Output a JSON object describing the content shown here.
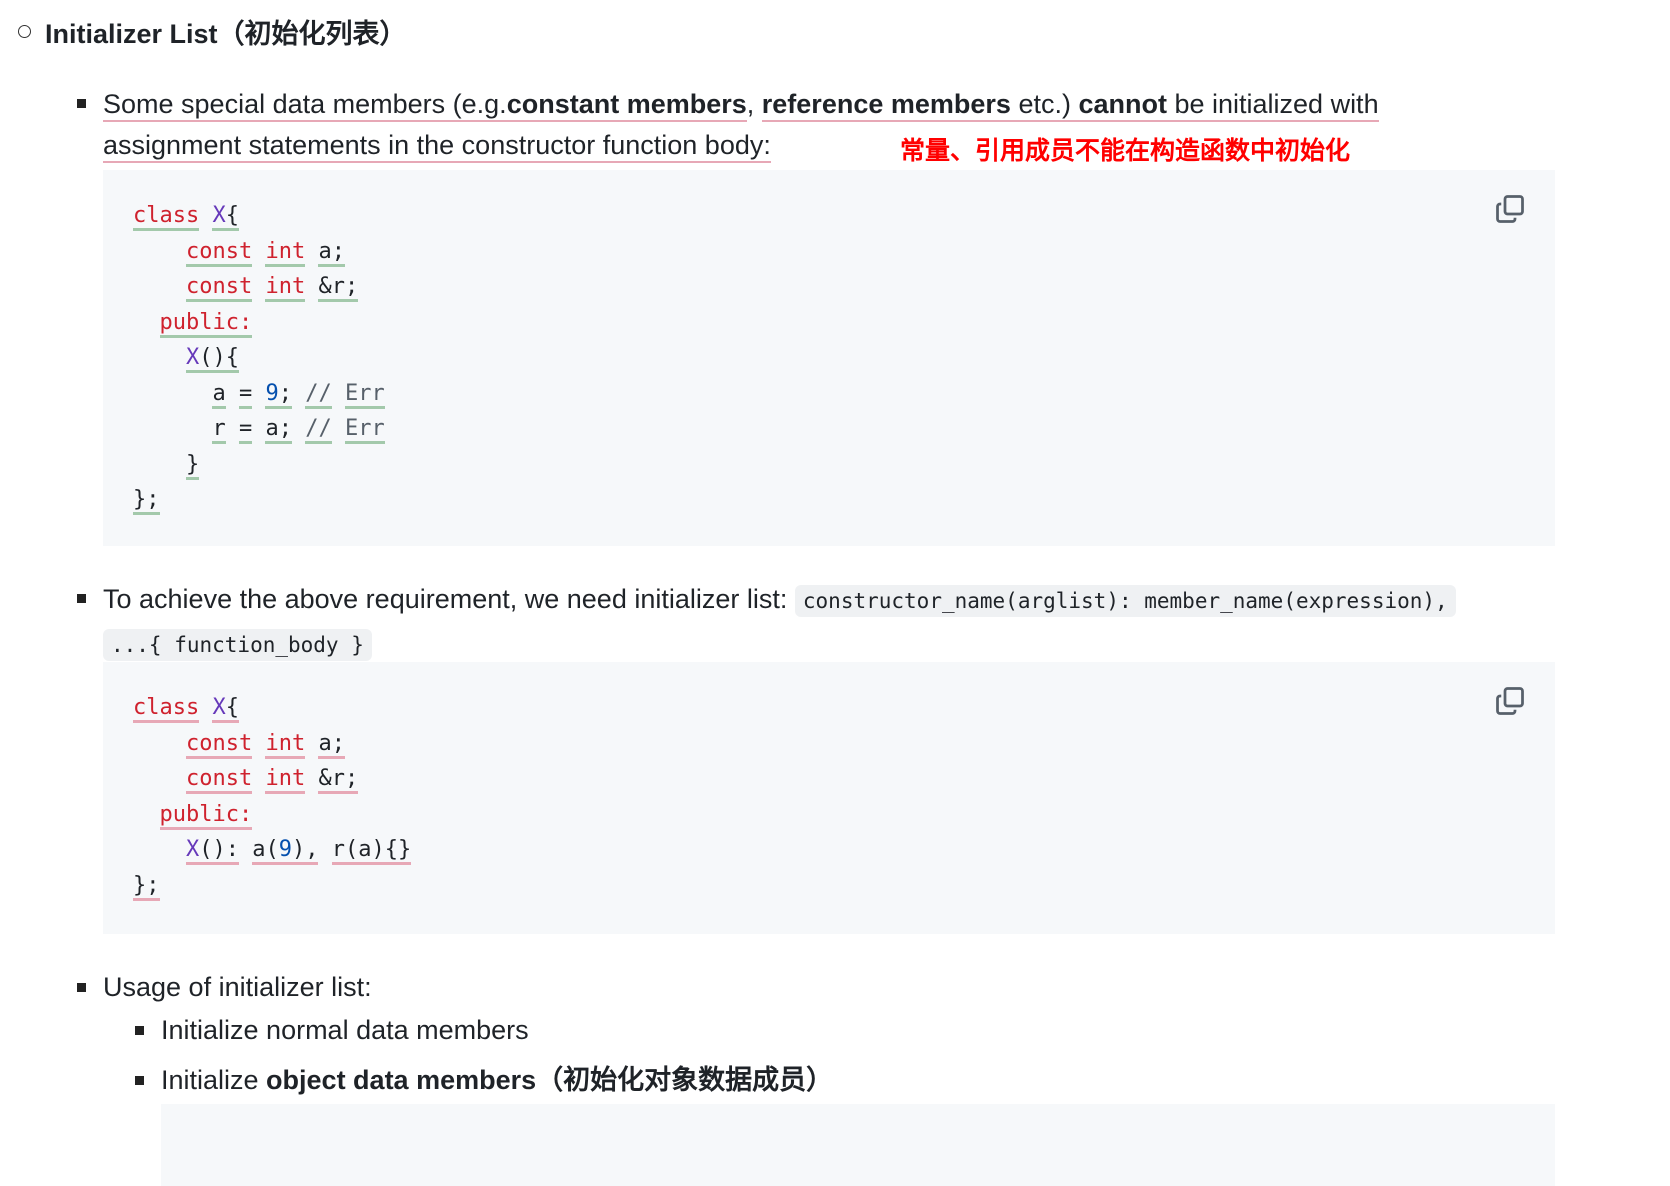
{
  "heading": "Initializer List（初始化列表）",
  "para1": {
    "t1": "Some special data members (e.g.",
    "b1": "constant members",
    "t2": ", ",
    "b2": "reference members",
    "t3": " etc.) ",
    "b3": "cannot",
    "t4": " be initialized with",
    "line2": "assignment statements in the constructor function body:",
    "note": "常量、引用成员不能在构造函数中初始化"
  },
  "code1": {
    "lines": [
      "class X{",
      "    const int a;",
      "    const int &r;",
      "  public:",
      "    X(){",
      "      a = 9; // Err",
      "      r = a; // Err",
      "    }",
      "};"
    ]
  },
  "para2": {
    "text": "To achieve the above requirement, we need initializer list:",
    "code_a": "constructor_name(arglist): member_name(expression),",
    "code_b": "...{ function_body }"
  },
  "code2": {
    "lines": [
      "class X{",
      "    const int a;",
      "    const int &r;",
      "  public:",
      "    X(): a(9), r(a){}",
      "};"
    ]
  },
  "para3": {
    "text": "Usage of initializer list:",
    "sub": [
      "Initialize normal data members"
    ],
    "sub2_plain": "Initialize ",
    "sub2_bold": "object data members（初始化对象数据成员）"
  },
  "icons": {
    "copy": "copy-icon"
  }
}
